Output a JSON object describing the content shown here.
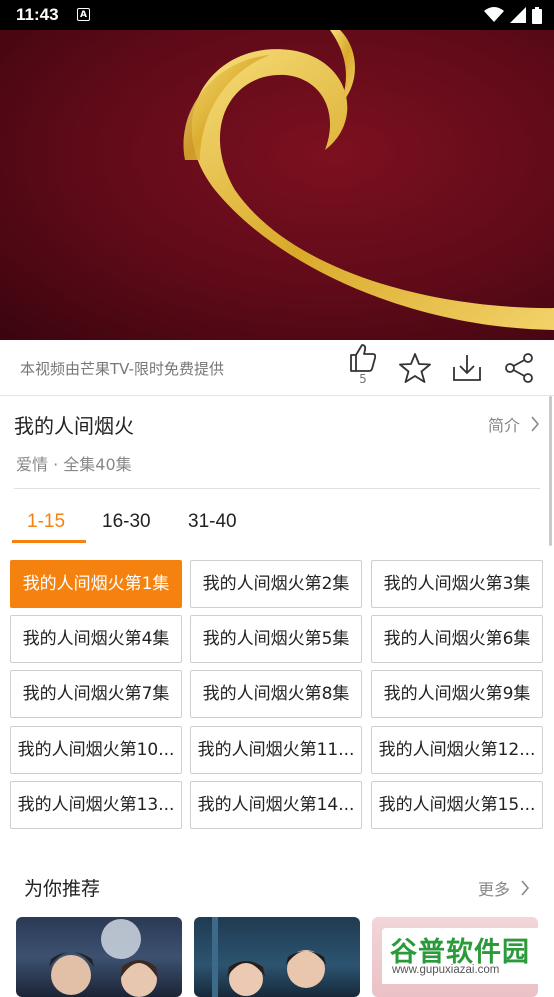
{
  "status_bar": {
    "time": "11:43",
    "badge": "A"
  },
  "player": {
    "provider_note": "本视频由芒果TV-限时免费提供",
    "like_count": "5"
  },
  "show": {
    "title": "我的人间烟火",
    "intro_label": "简介",
    "meta": "爱情 · 全集40集"
  },
  "range_tabs": [
    "1-15",
    "16-30",
    "31-40"
  ],
  "episodes": [
    "我的人间烟火第1集",
    "我的人间烟火第2集",
    "我的人间烟火第3集",
    "我的人间烟火第4集",
    "我的人间烟火第5集",
    "我的人间烟火第6集",
    "我的人间烟火第7集",
    "我的人间烟火第8集",
    "我的人间烟火第9集",
    "我的人间烟火第10...",
    "我的人间烟火第11...",
    "我的人间烟火第12...",
    "我的人间烟火第13...",
    "我的人间烟火第14...",
    "我的人间烟火第15..."
  ],
  "recommend": {
    "title": "为你推荐",
    "more_label": "更多"
  },
  "watermark": {
    "brand": "谷普软件园",
    "url": "www.gupuxiazai.com"
  },
  "colors": {
    "accent": "#f5820f",
    "video_bg": "#6b0c1c",
    "swirl": "#e8c24a"
  },
  "icons": [
    "thumb-up-icon",
    "star-icon",
    "download-icon",
    "share-icon",
    "chevron-right-icon",
    "wifi-icon",
    "signal-icon",
    "battery-icon"
  ]
}
